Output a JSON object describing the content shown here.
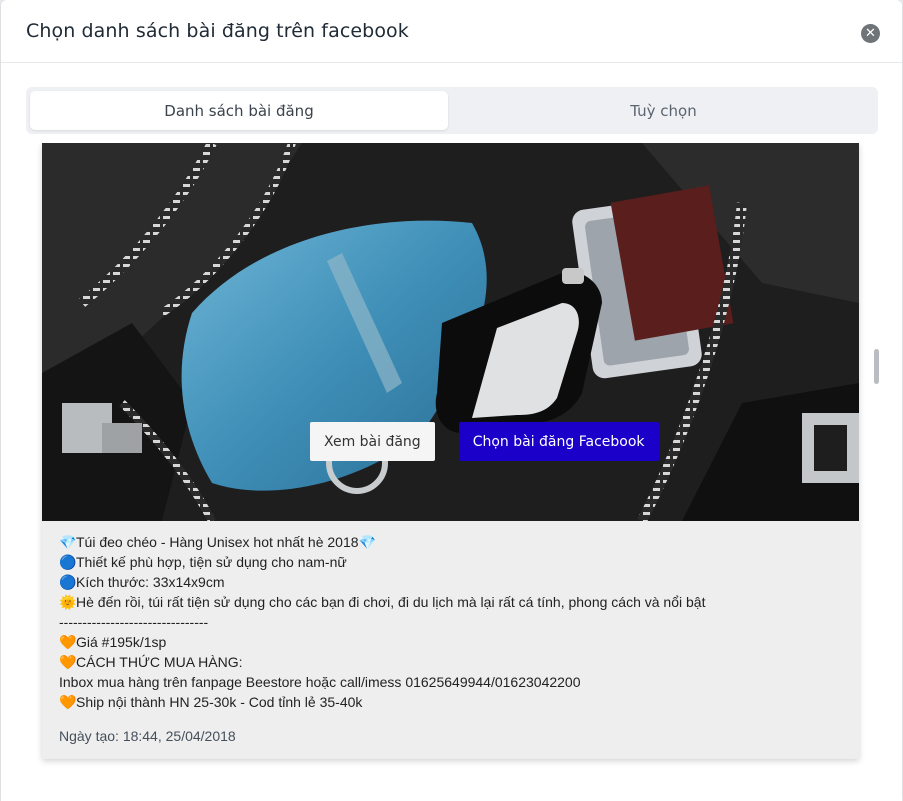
{
  "modal": {
    "title": "Chọn danh sách bài đăng trên facebook",
    "close_symbol": "✕"
  },
  "tabs": [
    {
      "label": "Danh sách bài đăng",
      "active": true
    },
    {
      "label": "Tuỳ chọn",
      "active": false
    }
  ],
  "post": {
    "image_description_icon": "bag-photo",
    "actions": {
      "view_label": "Xem bài đăng",
      "choose_label": "Chọn bài đăng Facebook"
    },
    "lines": [
      {
        "icon": "💎",
        "text": "Túi đeo chéo - Hàng Unisex hot nhất hè 2018",
        "suffix": "💎"
      },
      {
        "icon": "🔵",
        "text": "Thiết kế phù hợp, tiện sử dụng cho nam-nữ",
        "suffix": ""
      },
      {
        "icon": "🔵",
        "text": "Kích thước: 33x14x9cm",
        "suffix": ""
      },
      {
        "icon": "🌞",
        "text": "Hè đến rồi, túi rất tiện sử dụng cho các bạn đi chơi, đi du lịch mà lại rất cá tính, phong cách và nổi bật",
        "suffix": ""
      },
      {
        "icon": "",
        "text": "--------------------------------",
        "suffix": ""
      },
      {
        "icon": "🧡",
        "text": "Giá #195k/1sp",
        "suffix": ""
      },
      {
        "icon": "🧡",
        "text": "CÁCH THỨC MUA HÀNG:",
        "suffix": ""
      },
      {
        "icon": "",
        "text": "Inbox mua hàng trên fanpage Beestore hoặc call/imess 01625649944/01623042200",
        "suffix": ""
      },
      {
        "icon": "🧡",
        "text": "Ship nội thành HN 25-30k - Cod tỉnh lẻ 35-40k",
        "suffix": ""
      }
    ],
    "created_label": "Ngày tạo: 18:44, 25/04/2018"
  },
  "colors": {
    "primary_button": "#1a00c8",
    "tab_bg": "#eef0f3"
  }
}
